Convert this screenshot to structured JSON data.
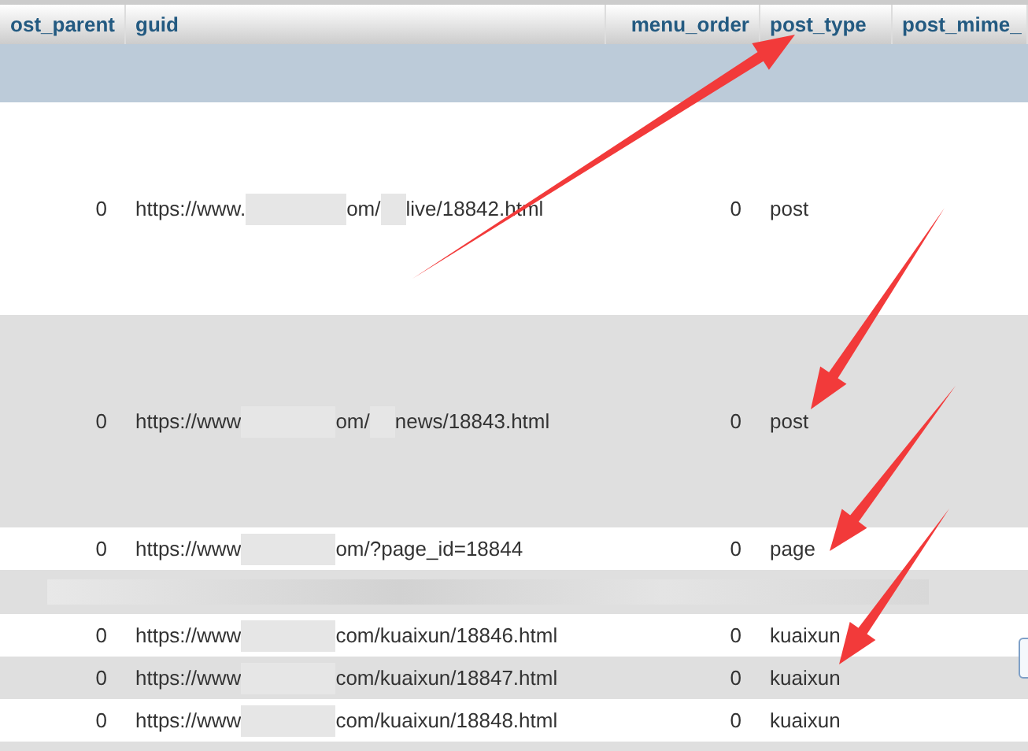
{
  "table": {
    "columns": [
      {
        "label": "ost_parent"
      },
      {
        "label": "guid"
      },
      {
        "label": "menu_order"
      },
      {
        "label": "post_type"
      },
      {
        "label": "post_mime_"
      }
    ],
    "rows": [
      {
        "kind": "tall",
        "post_parent": "0",
        "guid": [
          "https://www.",
          "om/",
          "live/18842.html"
        ],
        "menu_order": "0",
        "post_type": "post"
      },
      {
        "kind": "tall",
        "post_parent": "0",
        "guid": [
          "https://www",
          "om/",
          "news/18843.html"
        ],
        "menu_order": "0",
        "post_type": "post"
      },
      {
        "kind": "normal",
        "post_parent": "0",
        "guid": [
          "https://www",
          "om/?page_id=18844"
        ],
        "menu_order": "0",
        "post_type": "page"
      },
      {
        "kind": "redacted"
      },
      {
        "kind": "normal",
        "post_parent": "0",
        "guid": [
          "https://www",
          "com/kuaixun/18846.html"
        ],
        "menu_order": "0",
        "post_type": "kuaixun"
      },
      {
        "kind": "normal",
        "post_parent": "0",
        "guid": [
          "https://www",
          "com/kuaixun/18847.html"
        ],
        "menu_order": "0",
        "post_type": "kuaixun"
      },
      {
        "kind": "normal",
        "post_parent": "0",
        "guid": [
          "https://www",
          "com/kuaixun/18848.html"
        ],
        "menu_order": "0",
        "post_type": "kuaixun"
      }
    ]
  }
}
